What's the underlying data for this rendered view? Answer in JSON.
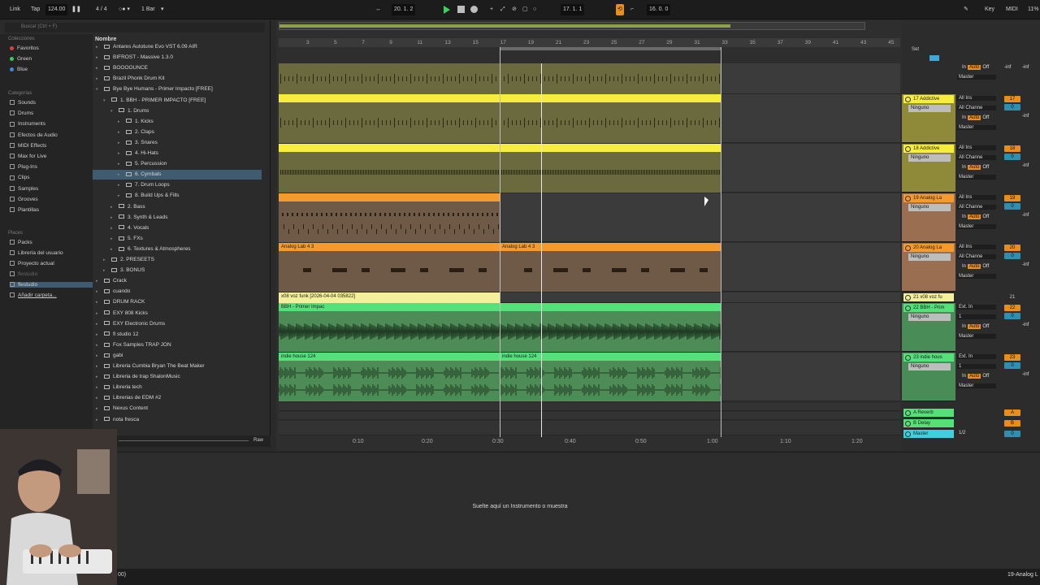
{
  "transport": {
    "link": "Link",
    "tap": "Tap",
    "tempo": "124.00",
    "time_sig": "4 / 4",
    "metronome": "○● ▾",
    "quant": "1 Bar",
    "position": "20.  1.  2",
    "loop_start": "17.  1.  1",
    "loop_length": "16.  0.  0",
    "key": "Key",
    "midi": "MIDI",
    "cpu": "11%"
  },
  "browser": {
    "search_placeholder": "Buscar (Ctrl + F)",
    "collections_header": "Colecciones",
    "collections": [
      {
        "label": "Favoritos",
        "color": "#e04040"
      },
      {
        "label": "Green",
        "color": "#3cc85a"
      },
      {
        "label": "Blue",
        "color": "#3c8ce0"
      }
    ],
    "categories_header": "Categorías",
    "categories": [
      "Sounds",
      "Drums",
      "Instruments",
      "Efectos de Audio",
      "MIDI Effects",
      "Max for Live",
      "Plug-Ins",
      "Clips",
      "Samples",
      "Grooves",
      "Plantillas"
    ],
    "places_header": "Places",
    "places": [
      "Packs",
      "Librería del usuario",
      "Proyecto actual",
      "flestudio",
      "flestudio",
      "Añadir carpeta..."
    ],
    "column_header": "Nombre",
    "files": [
      {
        "label": "Antares Autotune Evo VST 6.09 AIR",
        "indent": 0,
        "tri": "▸"
      },
      {
        "label": "BIFROST - Massive 1.3.0",
        "indent": 0,
        "tri": "▸"
      },
      {
        "label": "BOOOOUNCE",
        "indent": 0,
        "tri": "▸"
      },
      {
        "label": "Brazil Phonk Drum Kit",
        "indent": 0,
        "tri": "▸"
      },
      {
        "label": "Bye Bye Humans - Primer Impacto [FREE]",
        "indent": 0,
        "tri": "▾"
      },
      {
        "label": "1. BBH - PRIMER IMPACTO [FREE]",
        "indent": 1,
        "tri": "▾"
      },
      {
        "label": "1. Drums",
        "indent": 2,
        "tri": "▾"
      },
      {
        "label": "1. Kicks",
        "indent": 3,
        "tri": "▸"
      },
      {
        "label": "2. Claps",
        "indent": 3,
        "tri": "▸"
      },
      {
        "label": "3. Snares",
        "indent": 3,
        "tri": "▸"
      },
      {
        "label": "4. Hi-Hats",
        "indent": 3,
        "tri": "▸"
      },
      {
        "label": "5. Percussion",
        "indent": 3,
        "tri": "▸"
      },
      {
        "label": "6. Cymbals",
        "indent": 3,
        "tri": "▸",
        "selected": true
      },
      {
        "label": "7. Drum Loops",
        "indent": 3,
        "tri": "▸"
      },
      {
        "label": "8. Build Ups & Fills",
        "indent": 3,
        "tri": "▸"
      },
      {
        "label": "2. Bass",
        "indent": 2,
        "tri": "▸"
      },
      {
        "label": "3. Synth & Leads",
        "indent": 2,
        "tri": "▸"
      },
      {
        "label": "4. Vocals",
        "indent": 2,
        "tri": "▸"
      },
      {
        "label": "5. FXs",
        "indent": 2,
        "tri": "▸"
      },
      {
        "label": "6. Textures & Atmospheres",
        "indent": 2,
        "tri": "▸"
      },
      {
        "label": "2. PRESEETS",
        "indent": 1,
        "tri": "▸"
      },
      {
        "label": "3. BONUS",
        "indent": 1,
        "tri": "▸"
      },
      {
        "label": "Crack",
        "indent": 0,
        "tri": "▸"
      },
      {
        "label": "cuando",
        "indent": 0,
        "tri": "▸"
      },
      {
        "label": "DRUM RACK",
        "indent": 0,
        "tri": "▸"
      },
      {
        "label": "EXY 808 Kicks",
        "indent": 0,
        "tri": "▸"
      },
      {
        "label": "EXY Electronic Drums",
        "indent": 0,
        "tri": "▸"
      },
      {
        "label": "fl studio 12",
        "indent": 0,
        "tri": "▸"
      },
      {
        "label": "Fox Samples TRAP JON",
        "indent": 0,
        "tri": "▸"
      },
      {
        "label": "gabi",
        "indent": 0,
        "tri": "▸"
      },
      {
        "label": "Libreria Cumbia Bryan The Beat Maker",
        "indent": 0,
        "tri": "▸"
      },
      {
        "label": "Libreria de trap ShalonMusic",
        "indent": 0,
        "tri": "▸"
      },
      {
        "label": "Libreria tech",
        "indent": 0,
        "tri": "▸"
      },
      {
        "label": "Librerias de EDM #2",
        "indent": 0,
        "tri": "▸"
      },
      {
        "label": "Nexus Content",
        "indent": 0,
        "tri": "▸"
      },
      {
        "label": "nota fresca",
        "indent": 0,
        "tri": "▸"
      }
    ],
    "raw": "Raw"
  },
  "ruler": [
    "3",
    "5",
    "7",
    "9",
    "11",
    "13",
    "15",
    "17",
    "19",
    "21",
    "23",
    "25",
    "27",
    "29",
    "31",
    "33",
    "35",
    "37",
    "39",
    "41",
    "43",
    "45"
  ],
  "set_label": "Set",
  "clips": {
    "analog_lab": "Analog Lab 4 3",
    "analog_lab2": "Analog Lab 4 3",
    "x08_voz": "x08 voz funk [2026-04-04 035822]",
    "bbh_primer": "BBH - Primer Impac",
    "indie_house": "indie house 124",
    "indie_house2": "indie house 124"
  },
  "time_labels": [
    "0:10",
    "0:20",
    "0:30",
    "0:40",
    "0:50",
    "1:00",
    "1:10",
    "1:20"
  ],
  "mixer": {
    "tracks": [
      {
        "name": "17 Addictive",
        "color": "#f7ee3c",
        "input": "All Ins",
        "channel": "All Channe",
        "number": "17"
      },
      {
        "name": "18 Addictive",
        "color": "#f7ee3c",
        "input": "All Ins",
        "channel": "All Channe",
        "number": "18"
      },
      {
        "name": "19 Analog La",
        "color": "#f59a2c",
        "input": "All Ins",
        "channel": "All Channe",
        "number": "19"
      },
      {
        "name": "20 Analog La",
        "color": "#f59a2c",
        "input": "All Ins",
        "channel": "All Channe",
        "number": "20"
      },
      {
        "name": "21 x08 voz fu",
        "color": "#f3ef9a",
        "number": "21"
      },
      {
        "name": "22 BBH - Prim",
        "color": "#55e07a",
        "input": "Ext. In",
        "channel": "1",
        "number": "22"
      },
      {
        "name": "23 indie hous",
        "color": "#55e07a",
        "input": "Ext. In",
        "channel": "1",
        "number": "23"
      }
    ],
    "sub": "Ninguno",
    "monitor_in": "In",
    "monitor_auto": "Auto",
    "monitor_off": "Off",
    "output": "Master",
    "inf": "-inf",
    "zero": "0",
    "returns": [
      {
        "name": "A Reverb",
        "letter": "A"
      },
      {
        "name": "B Delay",
        "letter": "B"
      }
    ],
    "master": "Master",
    "master_ratio": "1/2"
  },
  "detail": {
    "drop_text": "Suelte aquí un Instrumento o muestra",
    "status_right": "19-Analog L",
    "status_left": "00)"
  }
}
